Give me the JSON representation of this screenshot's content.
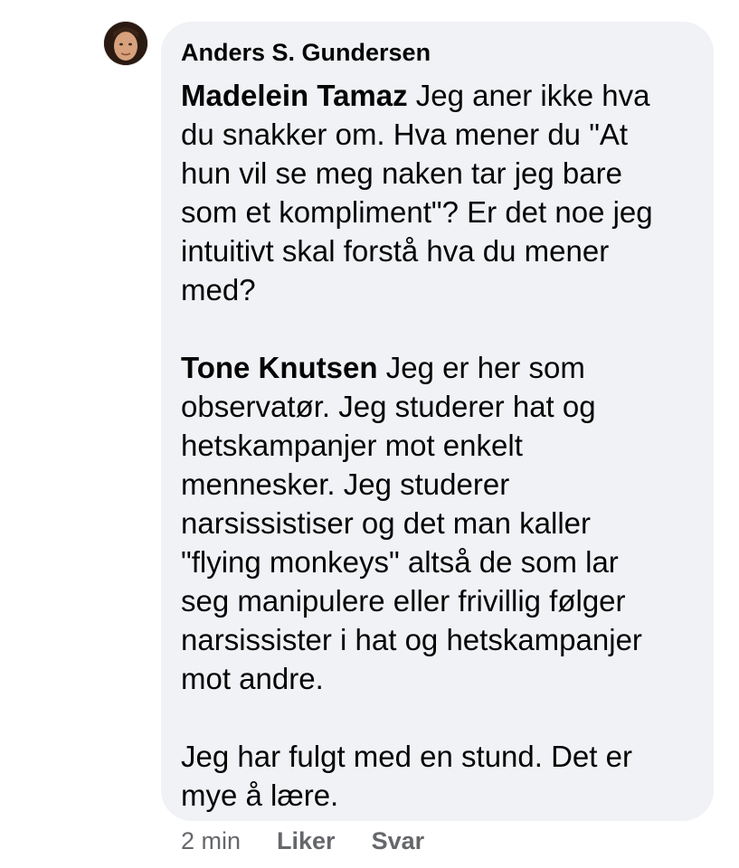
{
  "comment": {
    "author": "Anders S. Gundersen",
    "paragraphs": [
      {
        "mention": "Madelein Tamaz",
        "lines": [
          " Jeg aner ikke hva",
          "du snakker om. Hva mener du \"At",
          "hun vil se meg naken tar jeg bare",
          "som et kompliment\"?  Er det noe jeg",
          "intuitivt skal forstå hva du mener",
          "med?"
        ]
      },
      {
        "mention": "Tone Knutsen",
        "lines": [
          " Jeg er her som",
          "observatør. Jeg studerer hat og",
          "hetskampanjer mot enkelt",
          "mennesker. Jeg studerer",
          "narsissistiser og det man kaller",
          "\"flying monkeys\" altså de som lar",
          "seg manipulere eller frivillig følger",
          "narsissister i hat og hetskampanjer",
          "mot andre."
        ]
      },
      {
        "mention": "",
        "lines": [
          "Jeg har fulgt med en stund. Det er",
          "mye å lære."
        ]
      }
    ]
  },
  "actions": {
    "time": "2 min",
    "like": "Liker",
    "reply": "Svar"
  },
  "colors": {
    "bubble": "#f0f2f5",
    "text": "#050505",
    "meta": "#65676b"
  },
  "icons": {
    "avatar": "profile-photo"
  }
}
